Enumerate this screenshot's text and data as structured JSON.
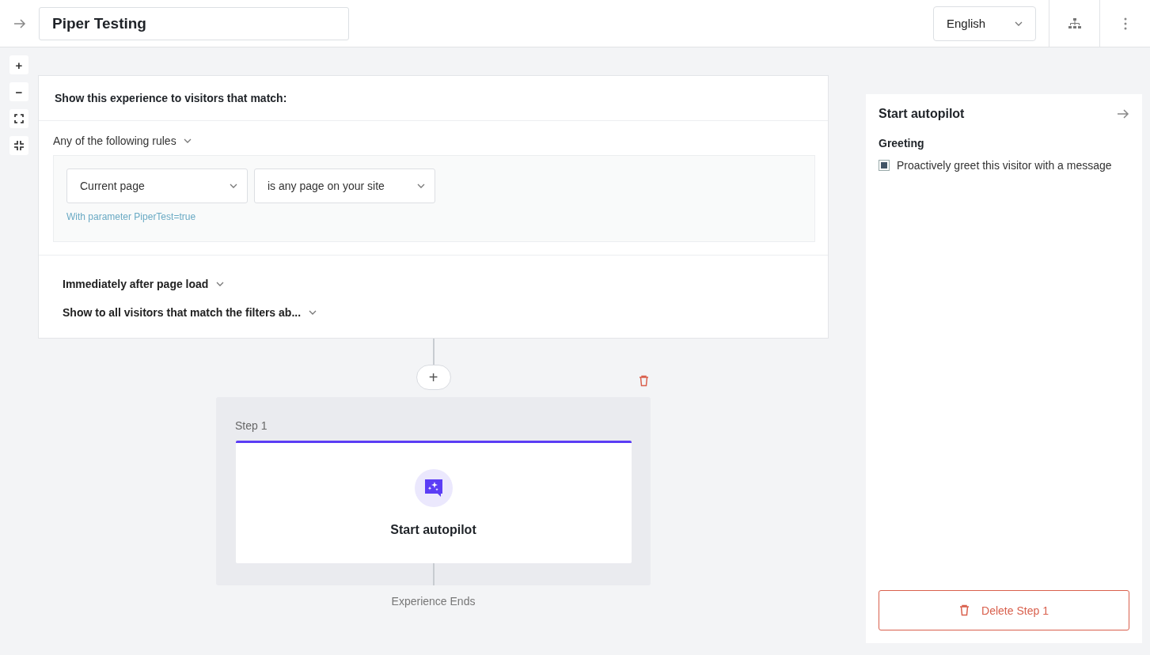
{
  "header": {
    "title": "Piper Testing",
    "language": "English"
  },
  "zoom_controls": [
    {
      "label": "+"
    },
    {
      "label": "−"
    }
  ],
  "audience": {
    "heading": "Show this experience to visitors that match:",
    "match_mode": "Any of the following rules",
    "rules": [
      {
        "field": "Current page",
        "condition": "is any page on your site",
        "note": "With parameter PiperTest=true"
      }
    ],
    "timing": [
      "Immediately after page load",
      "Show to all visitors that match the filters ab..."
    ]
  },
  "flow": {
    "add_label": "+",
    "step_label": "Step 1",
    "step_title": "Start autopilot",
    "end_label": "Experience Ends"
  },
  "panel": {
    "title": "Start autopilot",
    "section": "Greeting",
    "options": [
      {
        "label": "Proactively greet this visitor with a message",
        "checked": true
      }
    ],
    "delete_label": "Delete Step 1"
  }
}
